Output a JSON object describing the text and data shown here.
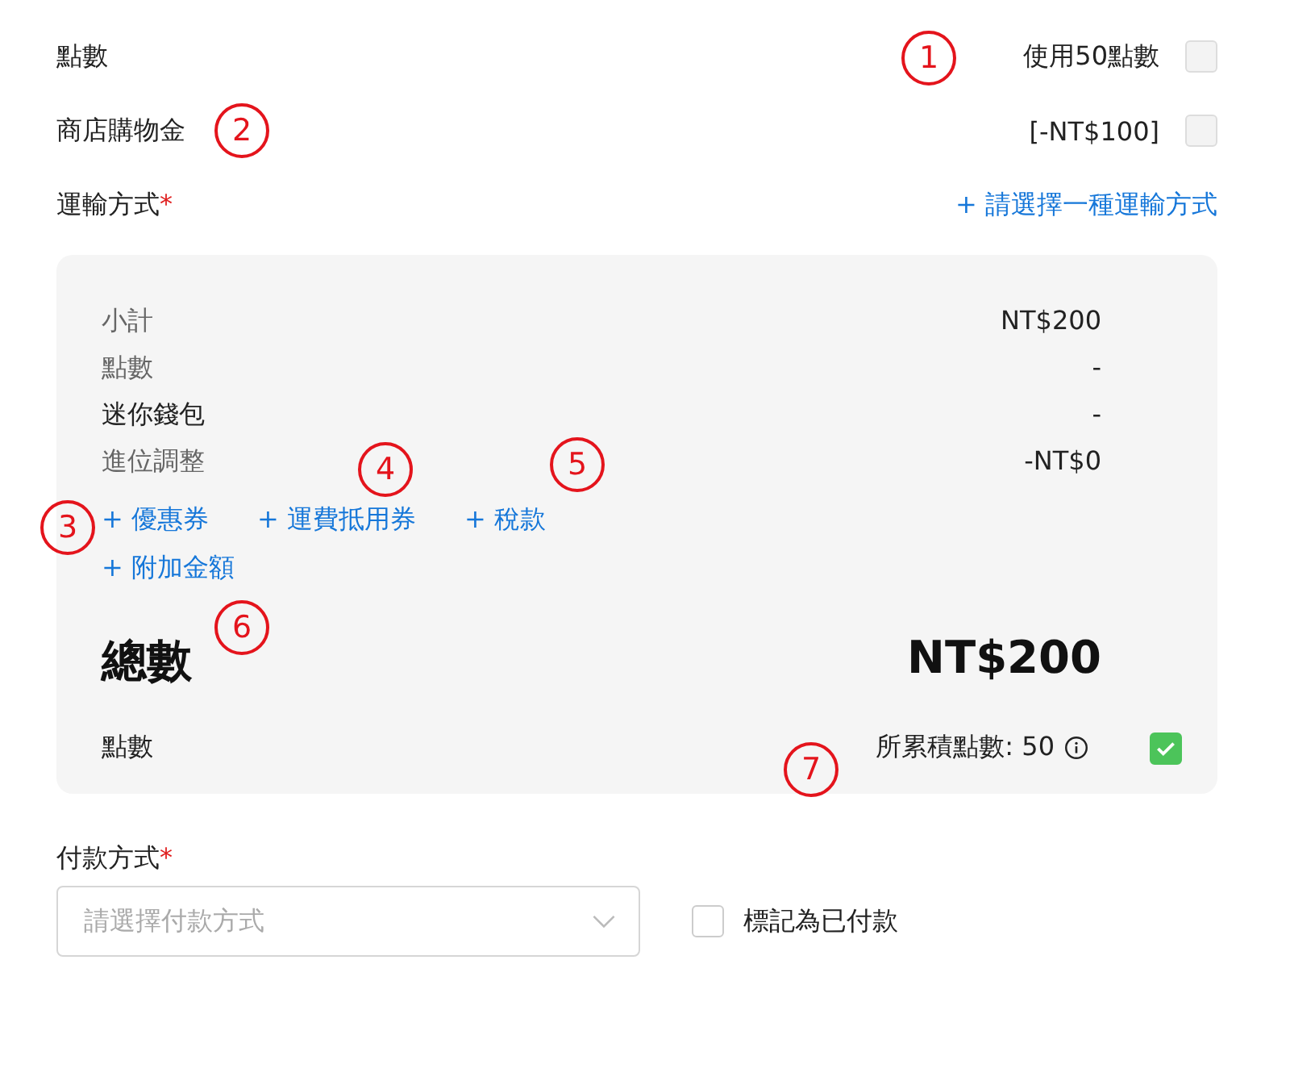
{
  "points_row": {
    "label": "點數",
    "option": "使用50點數",
    "checked": false
  },
  "store_credit_row": {
    "label": "商店購物金",
    "option": "[-NT$100]",
    "checked": false
  },
  "shipping": {
    "label": "運輸方式",
    "required_mark": "*",
    "action": "+ 請選擇一種運輸方式"
  },
  "summary": {
    "lines": [
      {
        "label": "小計",
        "value": "NT$200",
        "muted": true
      },
      {
        "label": "點數",
        "value": "-",
        "muted": true
      },
      {
        "label": "迷你錢包",
        "value": "-",
        "muted": false
      },
      {
        "label": "進位調整",
        "value": "-NT$0",
        "muted": true
      }
    ],
    "add_links": [
      "+ 優惠券",
      "+ 運費抵用券",
      "+ 稅款",
      "+ 附加金額"
    ],
    "total_label": "總數",
    "total_value": "NT$200",
    "points": {
      "label": "點數",
      "earned": "所累積點數: 50",
      "checked": true
    }
  },
  "payment": {
    "label": "付款方式",
    "required_mark": "*",
    "placeholder": "請選擇付款方式",
    "mark_paid": {
      "label": "標記為已付款",
      "checked": false
    }
  },
  "callouts": [
    {
      "number": "1"
    },
    {
      "number": "2"
    },
    {
      "number": "3"
    },
    {
      "number": "4"
    },
    {
      "number": "5"
    },
    {
      "number": "6"
    },
    {
      "number": "7"
    }
  ]
}
